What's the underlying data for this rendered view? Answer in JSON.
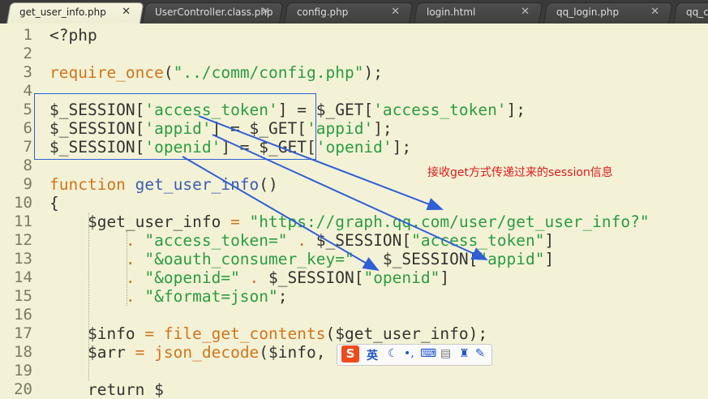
{
  "tabs": [
    {
      "label": "get_user_info.php",
      "active": true
    },
    {
      "label": "UserController.class.php",
      "active": false
    },
    {
      "label": "config.php",
      "active": false
    },
    {
      "label": "login.html",
      "active": false
    },
    {
      "label": "qq_login.php",
      "active": false
    },
    {
      "label": "qq_ca",
      "active": false
    }
  ],
  "close_glyph": "✕",
  "line_numbers": [
    "1",
    "2",
    "3",
    "4",
    "5",
    "6",
    "7",
    "8",
    "9",
    "10",
    "11",
    "12",
    "13",
    "14",
    "15",
    "16",
    "17",
    "18",
    "19",
    "20"
  ],
  "code_lines": [
    [
      {
        "t": "<?php",
        "c": "d"
      }
    ],
    [],
    [
      {
        "t": "require_once",
        "c": "k"
      },
      {
        "t": "(",
        "c": "d"
      },
      {
        "t": "\"../comm/config.php\"",
        "c": "s"
      },
      {
        "t": ");",
        "c": "d"
      }
    ],
    [],
    [
      {
        "t": "$_SESSION[",
        "c": "d"
      },
      {
        "t": "'access_token'",
        "c": "s"
      },
      {
        "t": "] = $_GET[",
        "c": "d"
      },
      {
        "t": "'access_token'",
        "c": "s"
      },
      {
        "t": "];",
        "c": "d"
      }
    ],
    [
      {
        "t": "$_SESSION[",
        "c": "d"
      },
      {
        "t": "'appid'",
        "c": "s"
      },
      {
        "t": "] = $_GET[",
        "c": "d"
      },
      {
        "t": "'appid'",
        "c": "s"
      },
      {
        "t": "];",
        "c": "d"
      }
    ],
    [
      {
        "t": "$_SESSION[",
        "c": "d"
      },
      {
        "t": "'openid'",
        "c": "s"
      },
      {
        "t": "] = $_GET[",
        "c": "d"
      },
      {
        "t": "'openid'",
        "c": "s"
      },
      {
        "t": "];",
        "c": "d"
      }
    ],
    [],
    [
      {
        "t": "function ",
        "c": "k"
      },
      {
        "t": "get_user_info",
        "c": "f"
      },
      {
        "t": "()",
        "c": "d"
      }
    ],
    [
      {
        "t": "{",
        "c": "d"
      }
    ],
    [
      {
        "t": "    $get_user_info ",
        "c": "d"
      },
      {
        "t": "= ",
        "c": "k"
      },
      {
        "t": "\"https://graph.qq.com/user/get_user_info?\"",
        "c": "s"
      }
    ],
    [
      {
        "t": "        . ",
        "c": "k"
      },
      {
        "t": "\"access_token=\"",
        "c": "s"
      },
      {
        "t": " . ",
        "c": "k"
      },
      {
        "t": "$_SESSION[",
        "c": "d"
      },
      {
        "t": "\"access_token\"",
        "c": "s"
      },
      {
        "t": "]",
        "c": "d"
      }
    ],
    [
      {
        "t": "        . ",
        "c": "k"
      },
      {
        "t": "\"&oauth_consumer_key=\"",
        "c": "s"
      },
      {
        "t": " . ",
        "c": "k"
      },
      {
        "t": "$_SESSION[",
        "c": "d"
      },
      {
        "t": "\"appid\"",
        "c": "s"
      },
      {
        "t": "]",
        "c": "d"
      }
    ],
    [
      {
        "t": "        . ",
        "c": "k"
      },
      {
        "t": "\"&openid=\"",
        "c": "s"
      },
      {
        "t": " . ",
        "c": "k"
      },
      {
        "t": "$_SESSION[",
        "c": "d"
      },
      {
        "t": "\"openid\"",
        "c": "s"
      },
      {
        "t": "]",
        "c": "d"
      }
    ],
    [
      {
        "t": "        . ",
        "c": "k"
      },
      {
        "t": "\"&format=json\"",
        "c": "s"
      },
      {
        "t": ";",
        "c": "d"
      }
    ],
    [],
    [
      {
        "t": "    $info ",
        "c": "d"
      },
      {
        "t": "= ",
        "c": "k"
      },
      {
        "t": "file_get_contents",
        "c": "k"
      },
      {
        "t": "($get_user_info);",
        "c": "d"
      }
    ],
    [
      {
        "t": "    $arr ",
        "c": "d"
      },
      {
        "t": "= ",
        "c": "k"
      },
      {
        "t": "json_decode",
        "c": "k"
      },
      {
        "t": "($info, ",
        "c": "d"
      }
    ],
    [],
    [
      {
        "t": "    return $",
        "c": "d"
      }
    ]
  ],
  "colors": {
    "d": "#333333",
    "k": "#d1741c",
    "s": "#2a9d42",
    "f": "#3b5bb5",
    "bg": "#f4f2d6",
    "annotation": "#2f5fd6",
    "note": "#e21a1a"
  },
  "annotation_text": "接收get方式传递过来的session信息",
  "ime_toolbar": {
    "logo": "S",
    "label": "英",
    "icons": [
      "moon-icon",
      "punctuation-icon",
      "keyboard-icon",
      "soft-keyboard-icon",
      "skin-icon",
      "tools-icon"
    ]
  }
}
